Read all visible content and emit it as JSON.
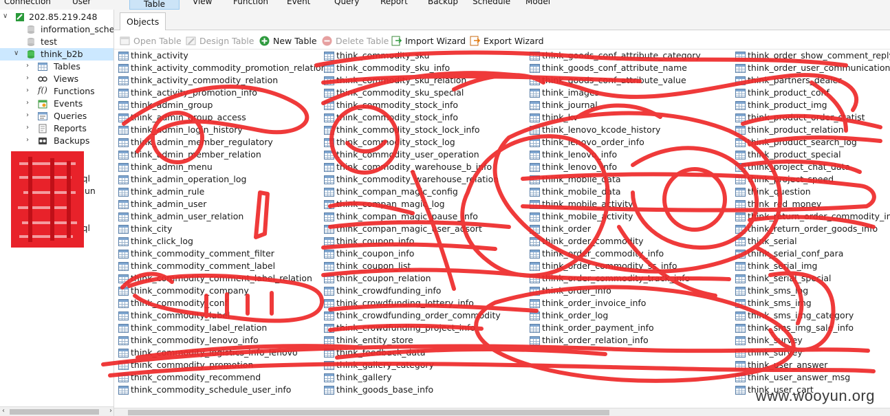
{
  "menubar": {
    "items": [
      "Connection",
      "User",
      "Table",
      "View",
      "Function",
      "Event",
      "Query",
      "Report",
      "Backup",
      "Schedule",
      "Model"
    ],
    "active": "Table"
  },
  "sidebar": {
    "connection": "202.85.219.248",
    "databases": [
      "information_schema",
      "test",
      "think_b2b"
    ],
    "selected_db": "think_b2b",
    "children": [
      "Tables",
      "Views",
      "Functions",
      "Events",
      "Queries",
      "Reports",
      "Backups"
    ],
    "redacted_partial": [
      "sql",
      "un",
      "sql"
    ]
  },
  "tabs": [
    "Objects"
  ],
  "toolbar": {
    "open_table": "Open Table",
    "design_table": "Design Table",
    "new_table": "New Table",
    "delete_table": "Delete Table",
    "import_wizard": "Import Wizard",
    "export_wizard": "Export Wizard"
  },
  "tables": {
    "col1": [
      "think_activity",
      "think_activity_commodity_promotion_relation",
      "think_activity_commodity_relation",
      "think_activity_promotion_info",
      "think_admin_group",
      "think_admin_group_access",
      "think_admin_login_history",
      "think_admin_member_regulatory",
      "think_admin_member_relation",
      "think_admin_menu",
      "think_admin_operation_log",
      "think_admin_rule",
      "think_admin_user",
      "think_admin_user_relation",
      "think_city",
      "think_click_log",
      "think_commodity_comment_filter",
      "think_commodity_comment_label",
      "think_commodity_comment_label_relation",
      "think_commodity_company",
      "think_commodity_conf",
      "think_commodity_label",
      "think_commodity_label_relation",
      "think_commodity_lenovo_info",
      "think_commodity_logistics_info_lenovo",
      "think_commodity_promotion",
      "think_commodity_recommend",
      "think_commodity_schedule_user_info"
    ],
    "col2": [
      "think_commodity_sku",
      "think_commodity_sku_info",
      "think_commodity_sku_relation",
      "think_commodity_sku_special",
      "think_commodity_stock_info",
      "think_commodity_stock_info",
      "think_commodity_stock_lock_info",
      "think_commodity_stock_log",
      "think_commodity_user_operation",
      "think_commodity_warehouse_b_info",
      "think_commodity_warehouse_relation",
      "think_compan_magic_config",
      "think_compan_magic_log",
      "think_compan_magic_pause_info",
      "think_compan_magic_user_adsort",
      "think_coupon_info",
      "think_coupon_info",
      "think_coupon_list",
      "think_coupon_relation",
      "think_crowdfunding_info",
      "think_crowdfunding_lottery_info",
      "think_crowdfunding_order_commodity",
      "think_crowdfunding_project_info",
      "think_entity_store",
      "think_feedback_data",
      "think_gallery_category",
      "think_gallery",
      "think_goods_base_info"
    ],
    "col3": [
      "think_goods_conf_attribute_category",
      "think_goods_conf_attribute_name",
      "think_goods_conf_attribute_value",
      "think_images",
      "think_journal",
      "think_kv",
      "think_lenovo_kcode_history",
      "think_lenovo_order_info",
      "think_lenovo_info",
      "think_lenovo_info",
      "think_mobile_data",
      "think_mobile_data",
      "think_mobile_activity",
      "think_mobile_activity",
      "think_order",
      "think_order_commodity",
      "think_order_commodity_info",
      "think_order_commodity_ss_info",
      "think_order_commodity_track_info",
      "think_order_info",
      "think_order_invoice_info",
      "think_order_log",
      "think_order_payment_info",
      "think_order_relation_info"
    ],
    "col4": [
      "think_order_show_comment_reply",
      "think_order_user_communication",
      "think_partners_dealer",
      "think_product_conf",
      "think_product_img",
      "think_product_order_statist",
      "think_product_relation",
      "think_product_search_log",
      "think_product_special",
      "think_project_chat_data",
      "think_project_speed",
      "think_question",
      "think_red_money",
      "think_return_order_commodity_info",
      "think_return_order_goods_info",
      "think_serial",
      "think_serial_conf_para",
      "think_serial_img",
      "think_serial_special",
      "think_sms_log",
      "think_sms_img",
      "think_sms_img_category",
      "think_sms_img_sale_info",
      "think_survey",
      "think_survey",
      "think_user_answer",
      "think_user_answer_msg",
      "think_user_cart"
    ]
  },
  "watermark": "www.wooyun.org"
}
